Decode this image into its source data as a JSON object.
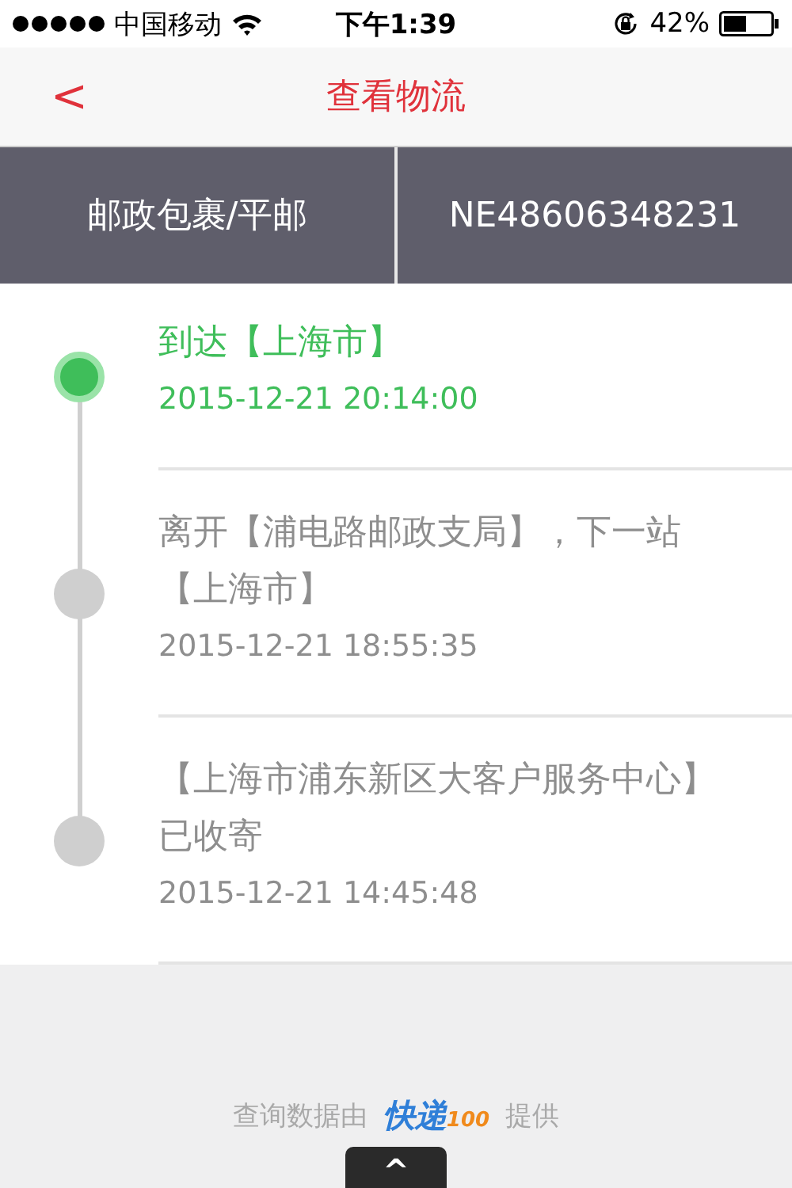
{
  "status_bar": {
    "carrier": "中国移动",
    "time": "下午1:39",
    "battery": "42%"
  },
  "nav": {
    "back": "<",
    "title": "查看物流"
  },
  "shipment": {
    "company": "邮政包裹/平邮",
    "number": "NE48606348231"
  },
  "tracking": [
    {
      "event": "到达【上海市】",
      "time": "2015-12-21 20:14:00",
      "current": true
    },
    {
      "event": "离开【浦电路邮政支局】，下一站【上海市】",
      "time": "2015-12-21 18:55:35",
      "current": false
    },
    {
      "event": "【上海市浦东新区大客户服务中心】已收寄",
      "time": "2015-12-21 14:45:48",
      "current": false
    }
  ],
  "footer": {
    "prefix": "查询数据由",
    "logo_main": "快递",
    "logo_num": "100",
    "suffix": "提供",
    "scroll_button": "^"
  }
}
